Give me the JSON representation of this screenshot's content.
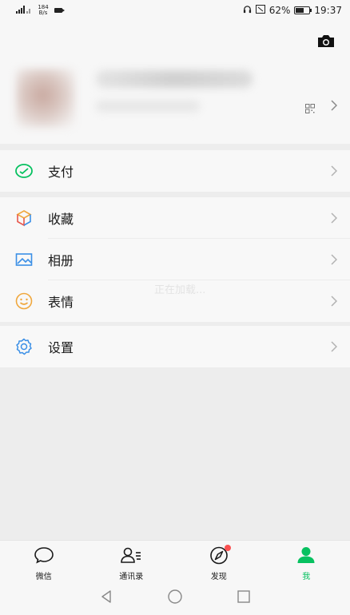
{
  "status_bar": {
    "signal1": "46",
    "net_speed_value": "184",
    "net_speed_unit": "B/s",
    "battery": "62%",
    "time": "19:37"
  },
  "loading_text": "正在加载...",
  "menu": {
    "pay": "支付",
    "favorites": "收藏",
    "album": "相册",
    "stickers": "表情",
    "settings": "设置"
  },
  "tabs": {
    "chats": "微信",
    "contacts": "通讯录",
    "discover": "发现",
    "me": "我"
  },
  "colors": {
    "accent": "#07c160",
    "badge": "#fa5151"
  },
  "icons": [
    "camera-icon",
    "qr-code-icon",
    "wallet-icon",
    "cube-icon",
    "image-icon",
    "smiley-icon",
    "gear-icon",
    "chat-bubble-icon",
    "contacts-icon",
    "compass-icon",
    "person-icon"
  ]
}
